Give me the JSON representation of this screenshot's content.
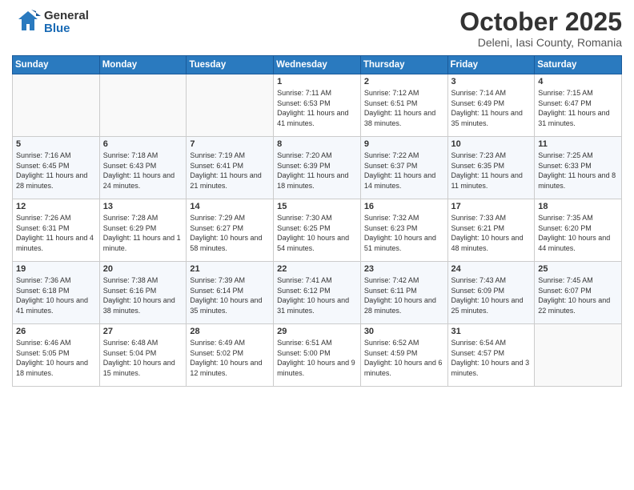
{
  "header": {
    "logo": {
      "general": "General",
      "blue": "Blue"
    },
    "title": "October 2025",
    "subtitle": "Deleni, Iasi County, Romania"
  },
  "days_of_week": [
    "Sunday",
    "Monday",
    "Tuesday",
    "Wednesday",
    "Thursday",
    "Friday",
    "Saturday"
  ],
  "weeks": [
    [
      {
        "day": "",
        "info": ""
      },
      {
        "day": "",
        "info": ""
      },
      {
        "day": "",
        "info": ""
      },
      {
        "day": "1",
        "info": "Sunrise: 7:11 AM\nSunset: 6:53 PM\nDaylight: 11 hours and 41 minutes."
      },
      {
        "day": "2",
        "info": "Sunrise: 7:12 AM\nSunset: 6:51 PM\nDaylight: 11 hours and 38 minutes."
      },
      {
        "day": "3",
        "info": "Sunrise: 7:14 AM\nSunset: 6:49 PM\nDaylight: 11 hours and 35 minutes."
      },
      {
        "day": "4",
        "info": "Sunrise: 7:15 AM\nSunset: 6:47 PM\nDaylight: 11 hours and 31 minutes."
      }
    ],
    [
      {
        "day": "5",
        "info": "Sunrise: 7:16 AM\nSunset: 6:45 PM\nDaylight: 11 hours and 28 minutes."
      },
      {
        "day": "6",
        "info": "Sunrise: 7:18 AM\nSunset: 6:43 PM\nDaylight: 11 hours and 24 minutes."
      },
      {
        "day": "7",
        "info": "Sunrise: 7:19 AM\nSunset: 6:41 PM\nDaylight: 11 hours and 21 minutes."
      },
      {
        "day": "8",
        "info": "Sunrise: 7:20 AM\nSunset: 6:39 PM\nDaylight: 11 hours and 18 minutes."
      },
      {
        "day": "9",
        "info": "Sunrise: 7:22 AM\nSunset: 6:37 PM\nDaylight: 11 hours and 14 minutes."
      },
      {
        "day": "10",
        "info": "Sunrise: 7:23 AM\nSunset: 6:35 PM\nDaylight: 11 hours and 11 minutes."
      },
      {
        "day": "11",
        "info": "Sunrise: 7:25 AM\nSunset: 6:33 PM\nDaylight: 11 hours and 8 minutes."
      }
    ],
    [
      {
        "day": "12",
        "info": "Sunrise: 7:26 AM\nSunset: 6:31 PM\nDaylight: 11 hours and 4 minutes."
      },
      {
        "day": "13",
        "info": "Sunrise: 7:28 AM\nSunset: 6:29 PM\nDaylight: 11 hours and 1 minute."
      },
      {
        "day": "14",
        "info": "Sunrise: 7:29 AM\nSunset: 6:27 PM\nDaylight: 10 hours and 58 minutes."
      },
      {
        "day": "15",
        "info": "Sunrise: 7:30 AM\nSunset: 6:25 PM\nDaylight: 10 hours and 54 minutes."
      },
      {
        "day": "16",
        "info": "Sunrise: 7:32 AM\nSunset: 6:23 PM\nDaylight: 10 hours and 51 minutes."
      },
      {
        "day": "17",
        "info": "Sunrise: 7:33 AM\nSunset: 6:21 PM\nDaylight: 10 hours and 48 minutes."
      },
      {
        "day": "18",
        "info": "Sunrise: 7:35 AM\nSunset: 6:20 PM\nDaylight: 10 hours and 44 minutes."
      }
    ],
    [
      {
        "day": "19",
        "info": "Sunrise: 7:36 AM\nSunset: 6:18 PM\nDaylight: 10 hours and 41 minutes."
      },
      {
        "day": "20",
        "info": "Sunrise: 7:38 AM\nSunset: 6:16 PM\nDaylight: 10 hours and 38 minutes."
      },
      {
        "day": "21",
        "info": "Sunrise: 7:39 AM\nSunset: 6:14 PM\nDaylight: 10 hours and 35 minutes."
      },
      {
        "day": "22",
        "info": "Sunrise: 7:41 AM\nSunset: 6:12 PM\nDaylight: 10 hours and 31 minutes."
      },
      {
        "day": "23",
        "info": "Sunrise: 7:42 AM\nSunset: 6:11 PM\nDaylight: 10 hours and 28 minutes."
      },
      {
        "day": "24",
        "info": "Sunrise: 7:43 AM\nSunset: 6:09 PM\nDaylight: 10 hours and 25 minutes."
      },
      {
        "day": "25",
        "info": "Sunrise: 7:45 AM\nSunset: 6:07 PM\nDaylight: 10 hours and 22 minutes."
      }
    ],
    [
      {
        "day": "26",
        "info": "Sunrise: 6:46 AM\nSunset: 5:05 PM\nDaylight: 10 hours and 18 minutes."
      },
      {
        "day": "27",
        "info": "Sunrise: 6:48 AM\nSunset: 5:04 PM\nDaylight: 10 hours and 15 minutes."
      },
      {
        "day": "28",
        "info": "Sunrise: 6:49 AM\nSunset: 5:02 PM\nDaylight: 10 hours and 12 minutes."
      },
      {
        "day": "29",
        "info": "Sunrise: 6:51 AM\nSunset: 5:00 PM\nDaylight: 10 hours and 9 minutes."
      },
      {
        "day": "30",
        "info": "Sunrise: 6:52 AM\nSunset: 4:59 PM\nDaylight: 10 hours and 6 minutes."
      },
      {
        "day": "31",
        "info": "Sunrise: 6:54 AM\nSunset: 4:57 PM\nDaylight: 10 hours and 3 minutes."
      },
      {
        "day": "",
        "info": ""
      }
    ]
  ]
}
